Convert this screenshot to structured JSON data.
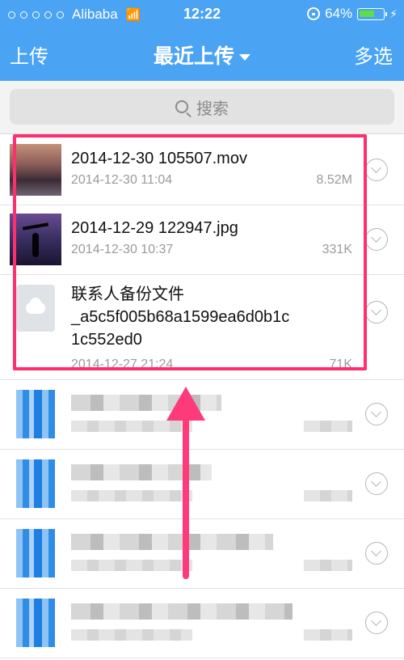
{
  "status": {
    "carrier": "Alibaba",
    "time": "12:22",
    "battery": "64%",
    "battery_level": 0.64
  },
  "nav": {
    "left": "上传",
    "title": "最近上传",
    "right": "多选"
  },
  "search": {
    "placeholder": "搜索"
  },
  "files": [
    {
      "name": "2014-12-30 105507.mov",
      "date": "2014-12-30 11:04",
      "size": "8.52M",
      "thumb": "video-thumbnail"
    },
    {
      "name": "2014-12-29 122947.jpg",
      "date": "2014-12-30 10:37",
      "size": "331K",
      "thumb": "photo-thumbnail"
    },
    {
      "name": "联系人备份文件\n_a5c5f005b68a1599ea6d0b1c\n1c552ed0",
      "date": "2014-12-27 21:24",
      "size": "71K",
      "thumb": "cloud-doc-icon"
    }
  ],
  "colors": {
    "nav_bg": "#4aa3f3",
    "highlight": "#ff2f6f"
  }
}
